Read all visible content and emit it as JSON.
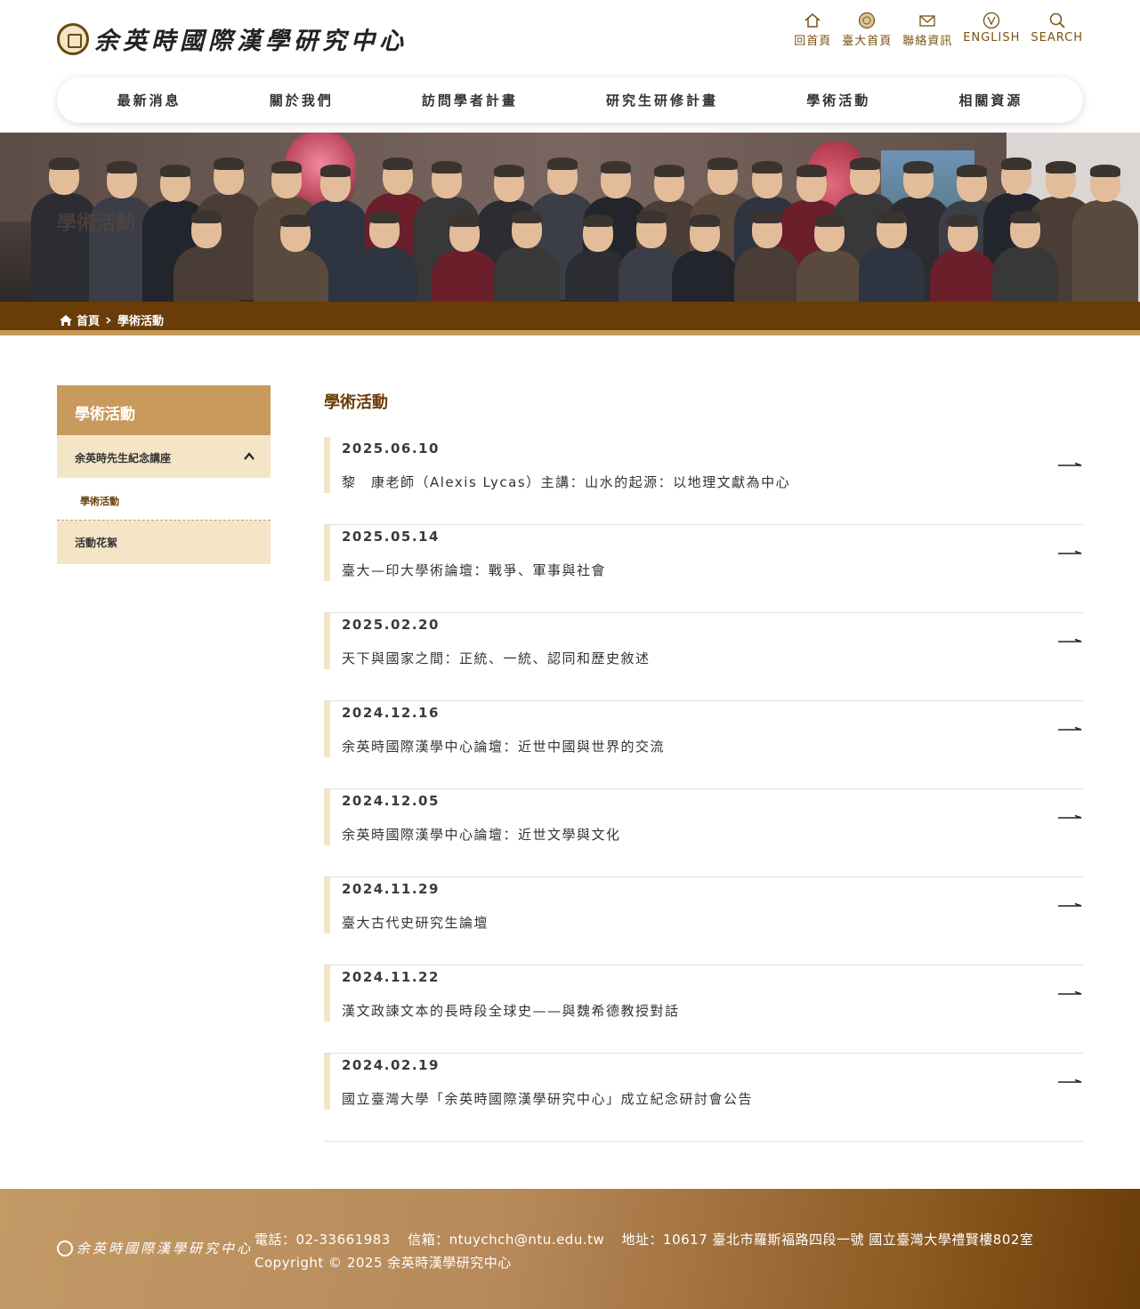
{
  "header": {
    "logo_text": "余英時國際漢學研究中心",
    "utility": [
      {
        "label": "回首頁",
        "icon": "home-icon"
      },
      {
        "label": "臺大首頁",
        "icon": "ntu-seal-icon"
      },
      {
        "label": "聯絡資訊",
        "icon": "mail-icon"
      },
      {
        "label": "ENGLISH",
        "icon": "english-icon"
      },
      {
        "label": "SEARCH",
        "icon": "search-icon"
      }
    ],
    "nav": [
      "最新消息",
      "關於我們",
      "訪問學者計畫",
      "研究生研修計畫",
      "學術活動",
      "相關資源"
    ]
  },
  "banner": {
    "title": "學術活動"
  },
  "breadcrumb": {
    "home": "首頁",
    "current": "學術活動"
  },
  "sidebar": {
    "title": "學術活動",
    "items": [
      {
        "label": "余英時先生紀念講座",
        "expanded": true
      },
      {
        "label": "學術活動"
      },
      {
        "label": "活動花絮"
      }
    ]
  },
  "main": {
    "title": "學術活動",
    "items": [
      {
        "date": "2025.06.10",
        "title": "黎　康老師（Alexis Lycas）主講：山水的起源：以地理文獻為中心"
      },
      {
        "date": "2025.05.14",
        "title": "臺大—印大學術論壇：戰爭、軍事與社會"
      },
      {
        "date": "2025.02.20",
        "title": "天下與國家之間：正統、一統、認同和歷史敘述"
      },
      {
        "date": "2024.12.16",
        "title": "余英時國際漢學中心論壇：近世中國與世界的交流"
      },
      {
        "date": "2024.12.05",
        "title": "余英時國際漢學中心論壇：近世文學與文化"
      },
      {
        "date": "2024.11.29",
        "title": "臺大古代史研究生論壇"
      },
      {
        "date": "2024.11.22",
        "title": "漢文政諫文本的長時段全球史——與魏希德教授對話"
      },
      {
        "date": "2024.02.19",
        "title": "國立臺灣大學「余英時國際漢學研究中心」成立紀念研討會公告"
      }
    ]
  },
  "footer": {
    "logo_text": "余英時國際漢學研究中心",
    "phone": "電話：02-33661983",
    "email": "信箱：ntuychch@ntu.edu.tw",
    "address": "地址：10617 臺北市羅斯福路四段一號 國立臺灣大學禮賢樓802室",
    "copyright": "Copyright © 2025 余英時漢學研究中心"
  },
  "colors": {
    "brand_brown": "#6a3c07",
    "accent_gold": "#c89a5c",
    "sidebar_bg": "#f3e5c6"
  }
}
